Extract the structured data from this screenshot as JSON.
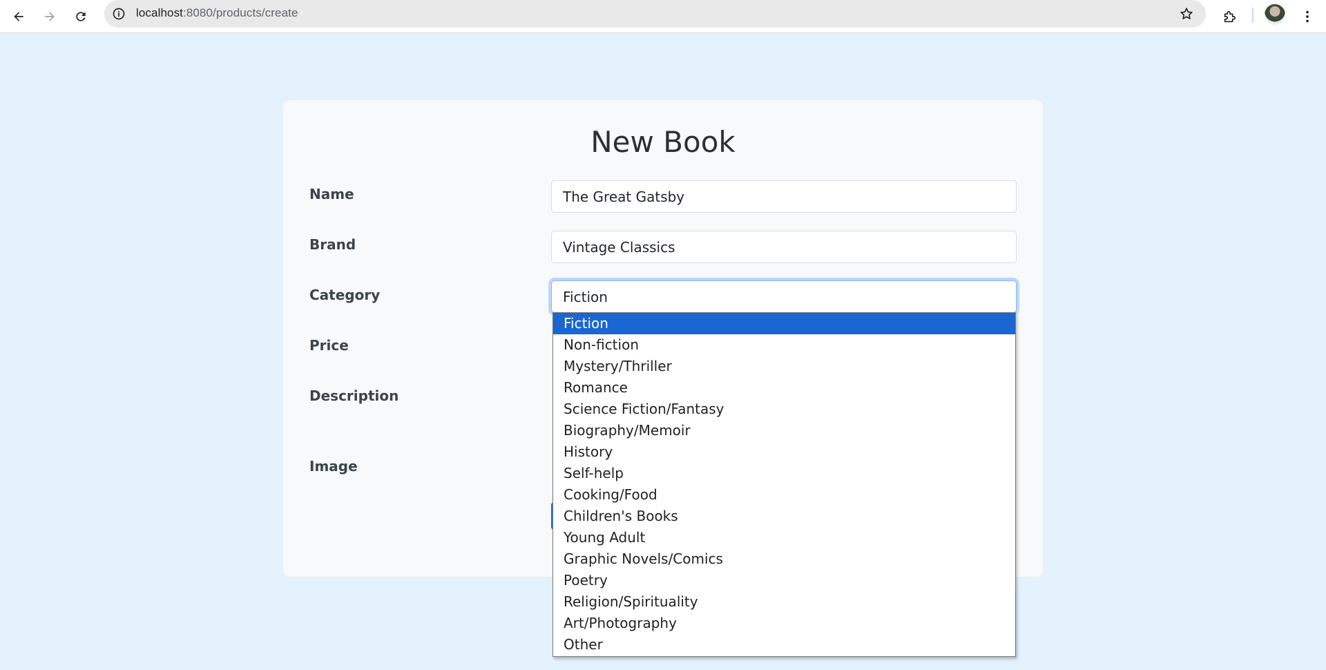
{
  "browser": {
    "url_host": "localhost",
    "url_path": ":8080/products/create"
  },
  "form": {
    "title": "New Book",
    "labels": {
      "name": "Name",
      "brand": "Brand",
      "category": "Category",
      "price": "Price",
      "description": "Description",
      "image": "Image"
    },
    "values": {
      "name": "The Great Gatsby",
      "brand": "Vintage Classics",
      "category": "Fiction"
    }
  },
  "category_options": [
    "Fiction",
    "Non-fiction",
    "Mystery/Thriller",
    "Romance",
    "Science Fiction/Fantasy",
    "Biography/Memoir",
    "History",
    "Self-help",
    "Cooking/Food",
    "Children's Books",
    "Young Adult",
    "Graphic Novels/Comics",
    "Poetry",
    "Religion/Spirituality",
    "Art/Photography",
    "Other"
  ],
  "selected_option": "Fiction",
  "colors": {
    "page_bg": "#e3f2fd",
    "card_bg": "#f8f9fa",
    "selected_bg": "#1a66d2",
    "accent": "#0d6efd"
  }
}
